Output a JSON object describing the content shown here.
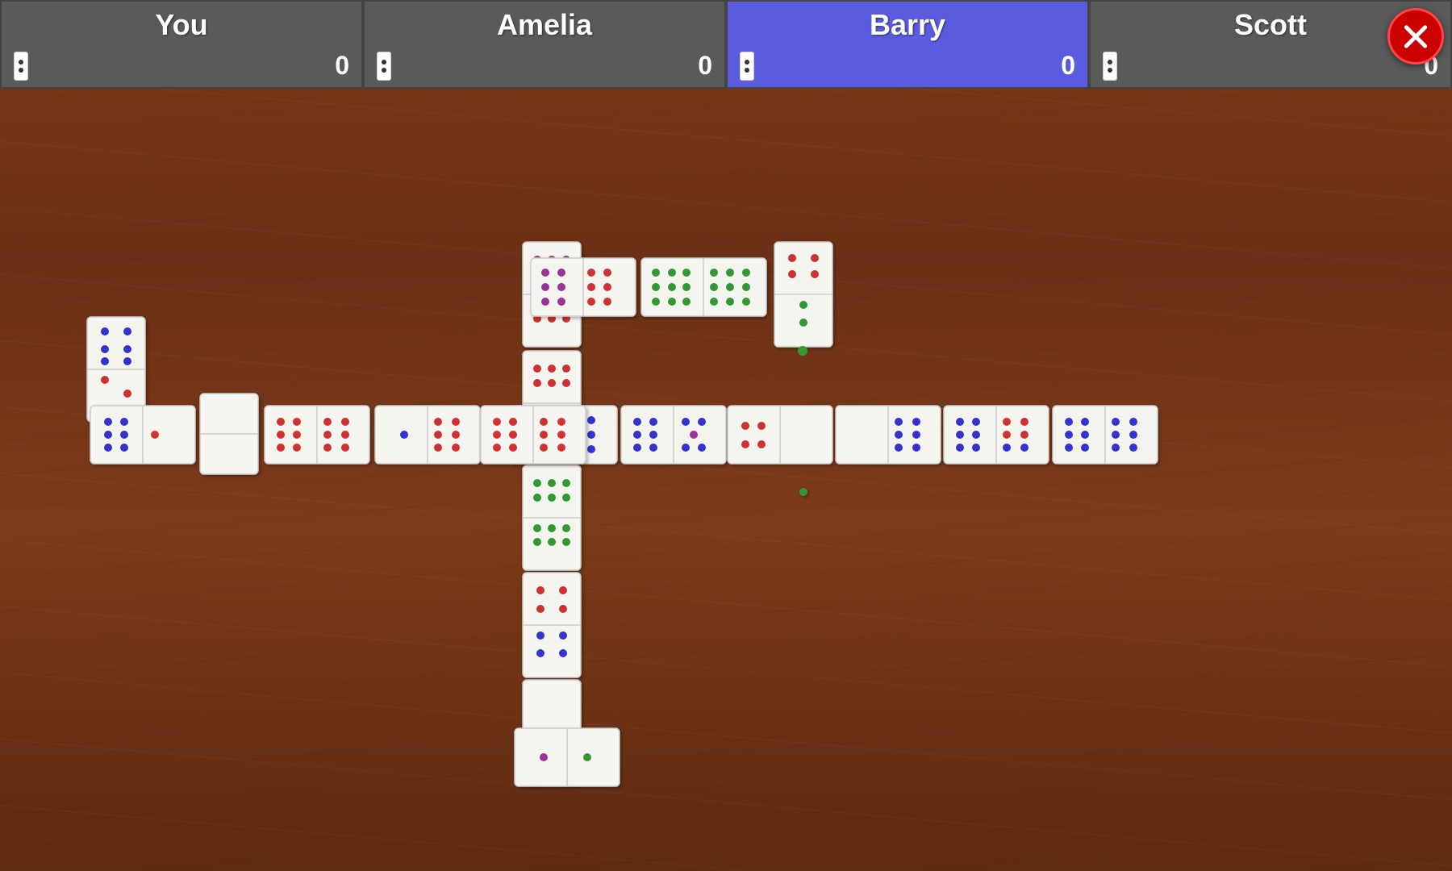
{
  "header": {
    "players": [
      {
        "name": "You",
        "score": "0",
        "active": false
      },
      {
        "name": "Amelia",
        "score": "0",
        "active": false
      },
      {
        "name": "Barry",
        "score": "0",
        "active": true
      },
      {
        "name": "Scott",
        "score": "0",
        "active": false
      }
    ]
  },
  "close_button_label": "X",
  "colors": {
    "active_player_bg": "#5b5be0",
    "inactive_player_bg": "#5a5a5a",
    "close_button": "#cc0000"
  }
}
